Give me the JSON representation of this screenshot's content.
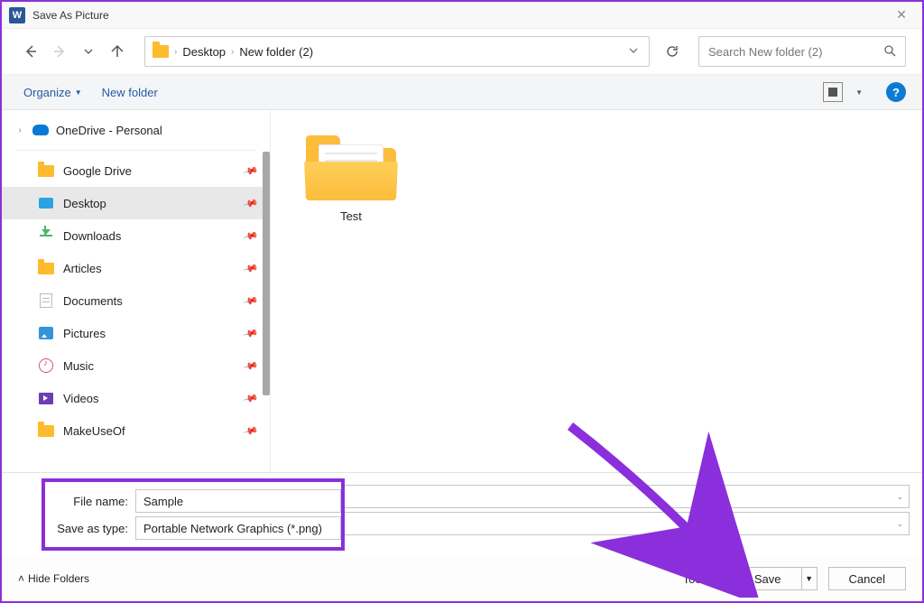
{
  "window": {
    "title": "Save As Picture"
  },
  "breadcrumb": {
    "items": [
      "Desktop",
      "New folder (2)"
    ]
  },
  "search": {
    "placeholder": "Search New folder (2)"
  },
  "toolbar": {
    "organize": "Organize",
    "newfolder": "New folder"
  },
  "sidebar": {
    "onedrive": "OneDrive - Personal",
    "items": [
      {
        "label": "Google Drive",
        "icon": "folder"
      },
      {
        "label": "Desktop",
        "icon": "desktop",
        "selected": true
      },
      {
        "label": "Downloads",
        "icon": "download"
      },
      {
        "label": "Articles",
        "icon": "folder"
      },
      {
        "label": "Documents",
        "icon": "doc"
      },
      {
        "label": "Pictures",
        "icon": "picture"
      },
      {
        "label": "Music",
        "icon": "music"
      },
      {
        "label": "Videos",
        "icon": "video"
      },
      {
        "label": "MakeUseOf",
        "icon": "folder"
      }
    ]
  },
  "content": {
    "folder_name": "Test"
  },
  "fields": {
    "filename_label": "File name:",
    "filename_value": "Sample",
    "filetype_label": "Save as type:",
    "filetype_value": "Portable Network Graphics (*.png)"
  },
  "footer": {
    "hide_folders": "Hide Folders",
    "tools": "Tools",
    "save": "Save",
    "cancel": "Cancel"
  }
}
